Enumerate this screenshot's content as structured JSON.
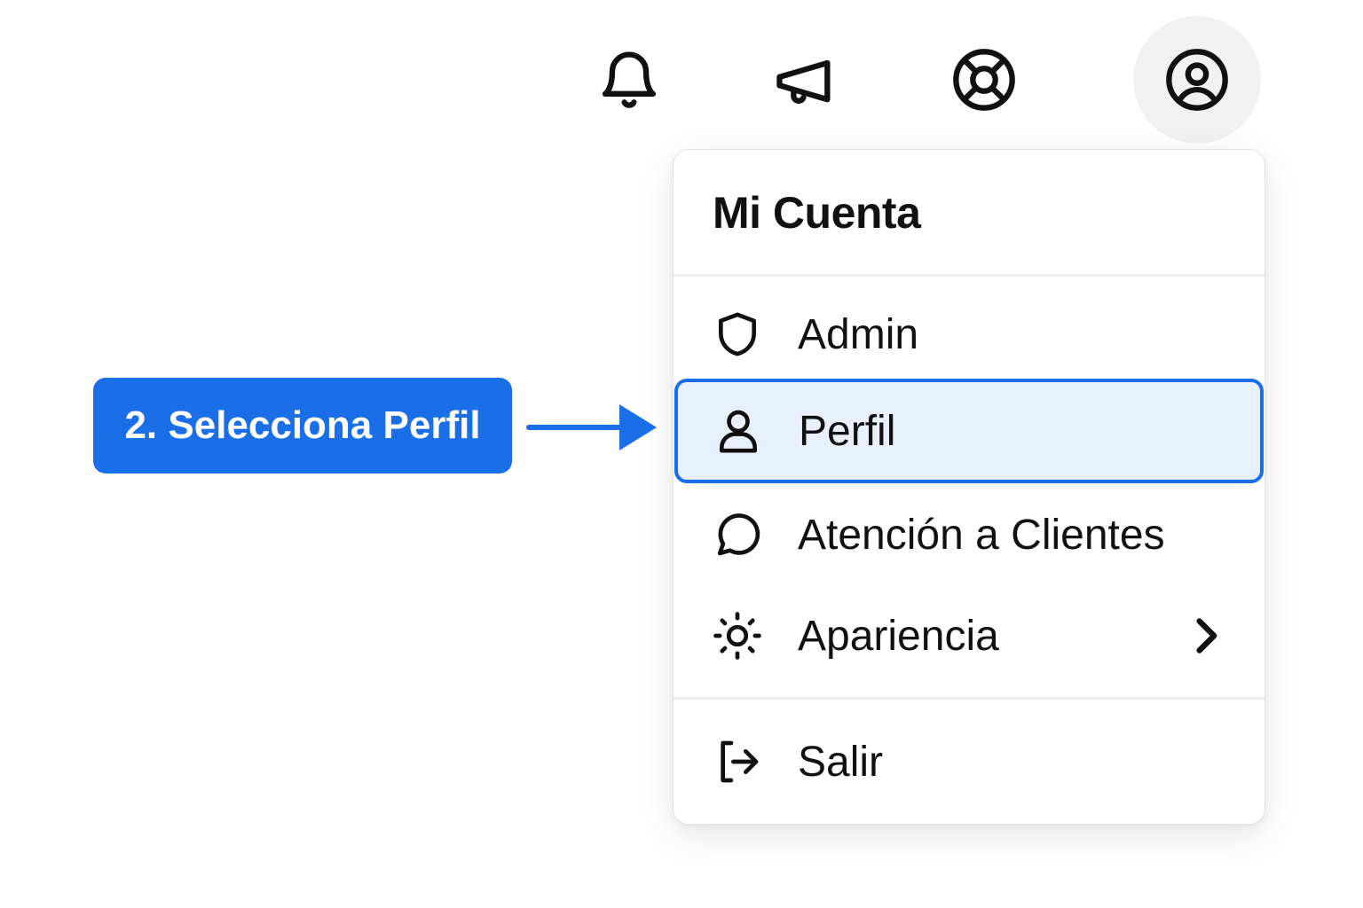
{
  "topbar": {
    "icons": [
      "bell-icon",
      "megaphone-icon",
      "lifebuoy-icon",
      "user-circle-icon"
    ]
  },
  "menu": {
    "title": "Mi Cuenta",
    "items": [
      {
        "label": "Admin",
        "icon": "shield-icon"
      },
      {
        "label": "Perfil",
        "icon": "user-icon",
        "highlighted": true
      },
      {
        "label": "Atención a Clientes",
        "icon": "chat-bubble-icon"
      },
      {
        "label": "Apariencia",
        "icon": "sun-icon",
        "has_submenu": true
      },
      {
        "label": "Salir",
        "icon": "logout-icon"
      }
    ]
  },
  "callout": {
    "text": "2. Selecciona Perfil"
  },
  "colors": {
    "accent": "#1a6ee8",
    "highlight_bg": "#e8f0fd",
    "account_button_bg": "#f1f1f1"
  }
}
